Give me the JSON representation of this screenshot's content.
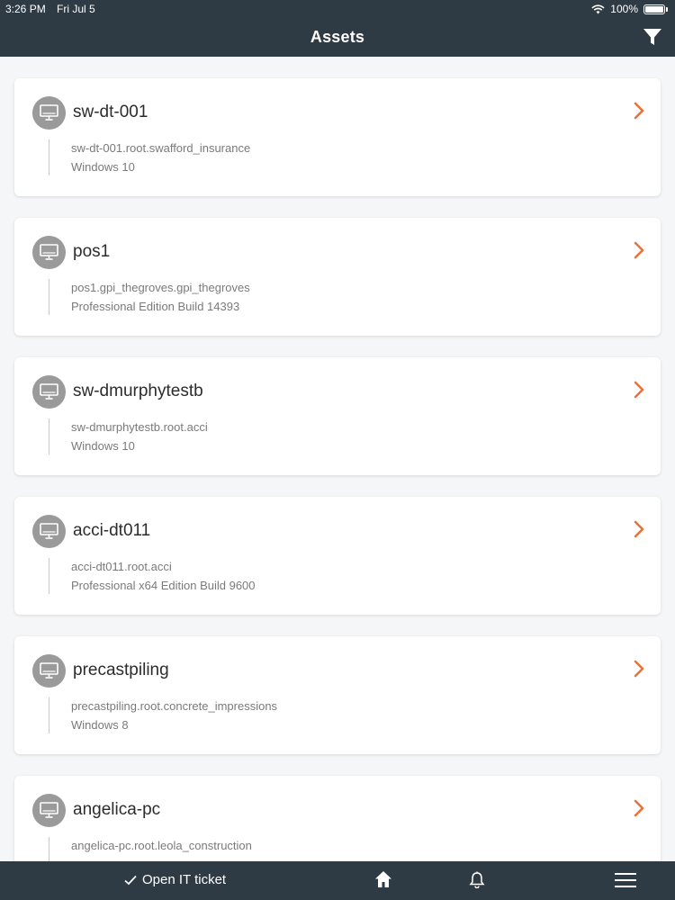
{
  "status_bar": {
    "time": "3:26 PM",
    "date": "Fri Jul 5",
    "battery": "100%"
  },
  "header": {
    "title": "Assets",
    "filter_icon": "filter-icon"
  },
  "assets": [
    {
      "name": "sw-dt-001",
      "host": "sw-dt-001.root.swafford_insurance",
      "os": "Windows 10"
    },
    {
      "name": "pos1",
      "host": "pos1.gpi_thegroves.gpi_thegroves",
      "os": "Professional Edition Build 14393"
    },
    {
      "name": "sw-dmurphytestb",
      "host": "sw-dmurphytestb.root.acci",
      "os": "Windows 10"
    },
    {
      "name": "acci-dt011",
      "host": "acci-dt011.root.acci",
      "os": "Professional x64 Edition Build 9600"
    },
    {
      "name": "precastpiling",
      "host": "precastpiling.root.concrete_impressions",
      "os": "Windows 8"
    },
    {
      "name": "angelica-pc",
      "host": "angelica-pc.root.leola_construction",
      "os": ""
    }
  ],
  "bottom_bar": {
    "open_ticket_label": "Open IT ticket"
  },
  "colors": {
    "bar": "#2e3a44",
    "accent": "#e8733a",
    "avatar": "#9a9a9a"
  }
}
